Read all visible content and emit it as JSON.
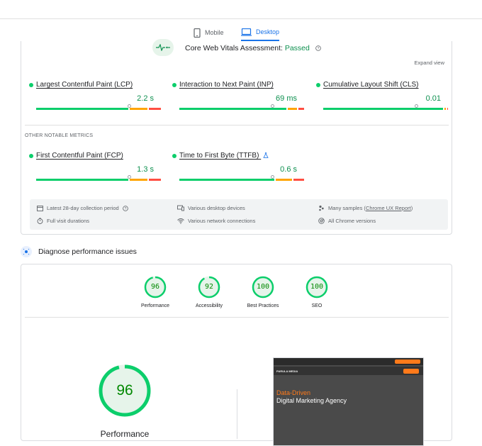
{
  "tabs": {
    "mobile": "Mobile",
    "desktop": "Desktop",
    "active": "Desktop"
  },
  "cwv": {
    "prefix": "Core Web Vitals Assessment:",
    "status": "Passed",
    "expand": "Expand view"
  },
  "metrics": [
    {
      "name": "Largest Contentful Paint (LCP)",
      "value": "2.2 s",
      "status_color": "#0cce6b",
      "good_fraction": 0.74,
      "marker": 0.75
    },
    {
      "name": "Interaction to Next Paint (INP)",
      "value": "69 ms",
      "status_color": "#0cce6b",
      "good_fraction": 0.86,
      "marker": 0.75
    },
    {
      "name": "Cumulative Layout Shift (CLS)",
      "value": "0.01",
      "status_color": "#0cce6b",
      "good_fraction": 0.96,
      "marker": 0.75
    }
  ],
  "other": {
    "heading": "OTHER NOTABLE METRICS",
    "metrics": [
      {
        "name": "First Contentful Paint (FCP)",
        "value": "1.3 s",
        "good_fraction": 0.74,
        "marker": 0.75
      },
      {
        "name": "Time to First Byte (TTFB)",
        "value": "0.6 s",
        "good_fraction": 0.76,
        "marker": 0.75
      }
    ]
  },
  "info": {
    "period": "Latest 28-day collection period",
    "visits": "Full visit durations",
    "devices": "Various desktop devices",
    "network": "Various network connections",
    "samples_prefix": "Many samples (",
    "samples_link": "Chrome UX Report",
    "samples_suffix": ")",
    "chrome": "All Chrome versions"
  },
  "diagnose": {
    "title": "Diagnose performance issues"
  },
  "scores": [
    {
      "score": "96",
      "label": "Performance",
      "fraction": 0.96
    },
    {
      "score": "92",
      "label": "Accessibility",
      "fraction": 0.92
    },
    {
      "score": "100",
      "label": "Best Practices",
      "fraction": 1.0
    },
    {
      "score": "100",
      "label": "SEO",
      "fraction": 1.0
    }
  ],
  "main": {
    "score": "96",
    "label": "Performance",
    "fraction": 0.96
  },
  "preview": {
    "brand": "PARULA MEDIA",
    "headline_accent": "Data-Driven",
    "headline": "Digital Marketing Agency"
  },
  "colors": {
    "good": "#0cce6b",
    "average": "#ffa400",
    "poor": "#ff4e42",
    "accent": "#1a73e8",
    "pass_text": "#0d904f"
  }
}
